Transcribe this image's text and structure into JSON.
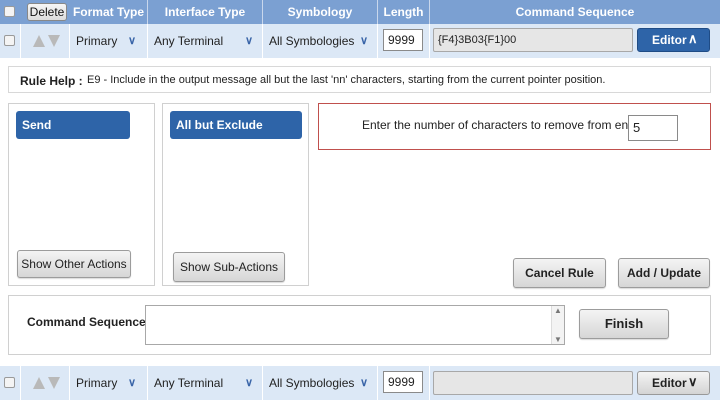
{
  "header": {
    "delete_label": "Delete",
    "columns": [
      "Format Type",
      "Interface Type",
      "Symbology",
      "Length",
      "Command Sequence"
    ]
  },
  "row1": {
    "format": "Primary",
    "interface": "Any Terminal",
    "symbology": "All Symbologies",
    "length": "9999",
    "command": "{F4}3B03{F1}00",
    "editor_label": "Editor",
    "editor_state": "expanded"
  },
  "rule_help": {
    "label": "Rule Help :",
    "text": "E9 - Include in the output message all but the last 'nn' characters, starting from the current pointer position."
  },
  "actions": {
    "selected": "Send",
    "show_other_label": "Show Other Actions"
  },
  "sub_actions": {
    "selected": "All but Exclude",
    "show_sub_label": "Show Sub-Actions"
  },
  "param": {
    "prompt": "Enter the number of characters to remove from end",
    "value": "5"
  },
  "rule_buttons": {
    "cancel_label": "Cancel Rule",
    "add_update_label": "Add / Update"
  },
  "command_sequence": {
    "label": "Command Sequence",
    "value": "",
    "finish_label": "Finish"
  },
  "row2": {
    "format": "Primary",
    "interface": "Any Terminal",
    "symbology": "All Symbologies",
    "length": "9999",
    "command": "",
    "editor_label": "Editor",
    "editor_state": "collapsed"
  },
  "colors": {
    "header_bg": "#7ba0d2",
    "row_bg": "#dce8f6",
    "accent": "#2e64a8",
    "param_border": "#c0504d"
  },
  "icons": [
    "checkbox-icon",
    "arrow-up-icon",
    "arrow-down-icon",
    "chevron-down-icon",
    "chevron-up-icon"
  ]
}
